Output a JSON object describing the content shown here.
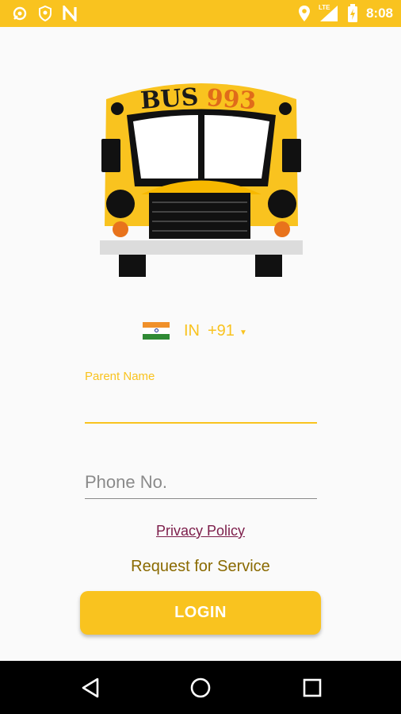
{
  "status_bar": {
    "time": "8:08",
    "network_label": "LTE",
    "left_icons": [
      "location-pin-icon",
      "shield-icon",
      "n-icon"
    ],
    "right_icons": [
      "location-icon",
      "signal-icon",
      "battery-charging-icon"
    ]
  },
  "logo": {
    "text_bus": "BUS",
    "text_number": "993"
  },
  "country_picker": {
    "iso": "IN",
    "dial_code": "+91"
  },
  "form": {
    "parent_name_label": "Parent Name",
    "parent_name_value": "",
    "phone_placeholder": "Phone No.",
    "phone_value": ""
  },
  "links": {
    "privacy_policy": "Privacy Policy",
    "request_service": "Request for Service"
  },
  "login_button": "LOGIN",
  "colors": {
    "accent": "#f9c31f",
    "privacy_link": "#7c1d4a",
    "request_text": "#8a6a00"
  },
  "nav_bar": [
    "back-icon",
    "home-icon",
    "recents-icon"
  ]
}
